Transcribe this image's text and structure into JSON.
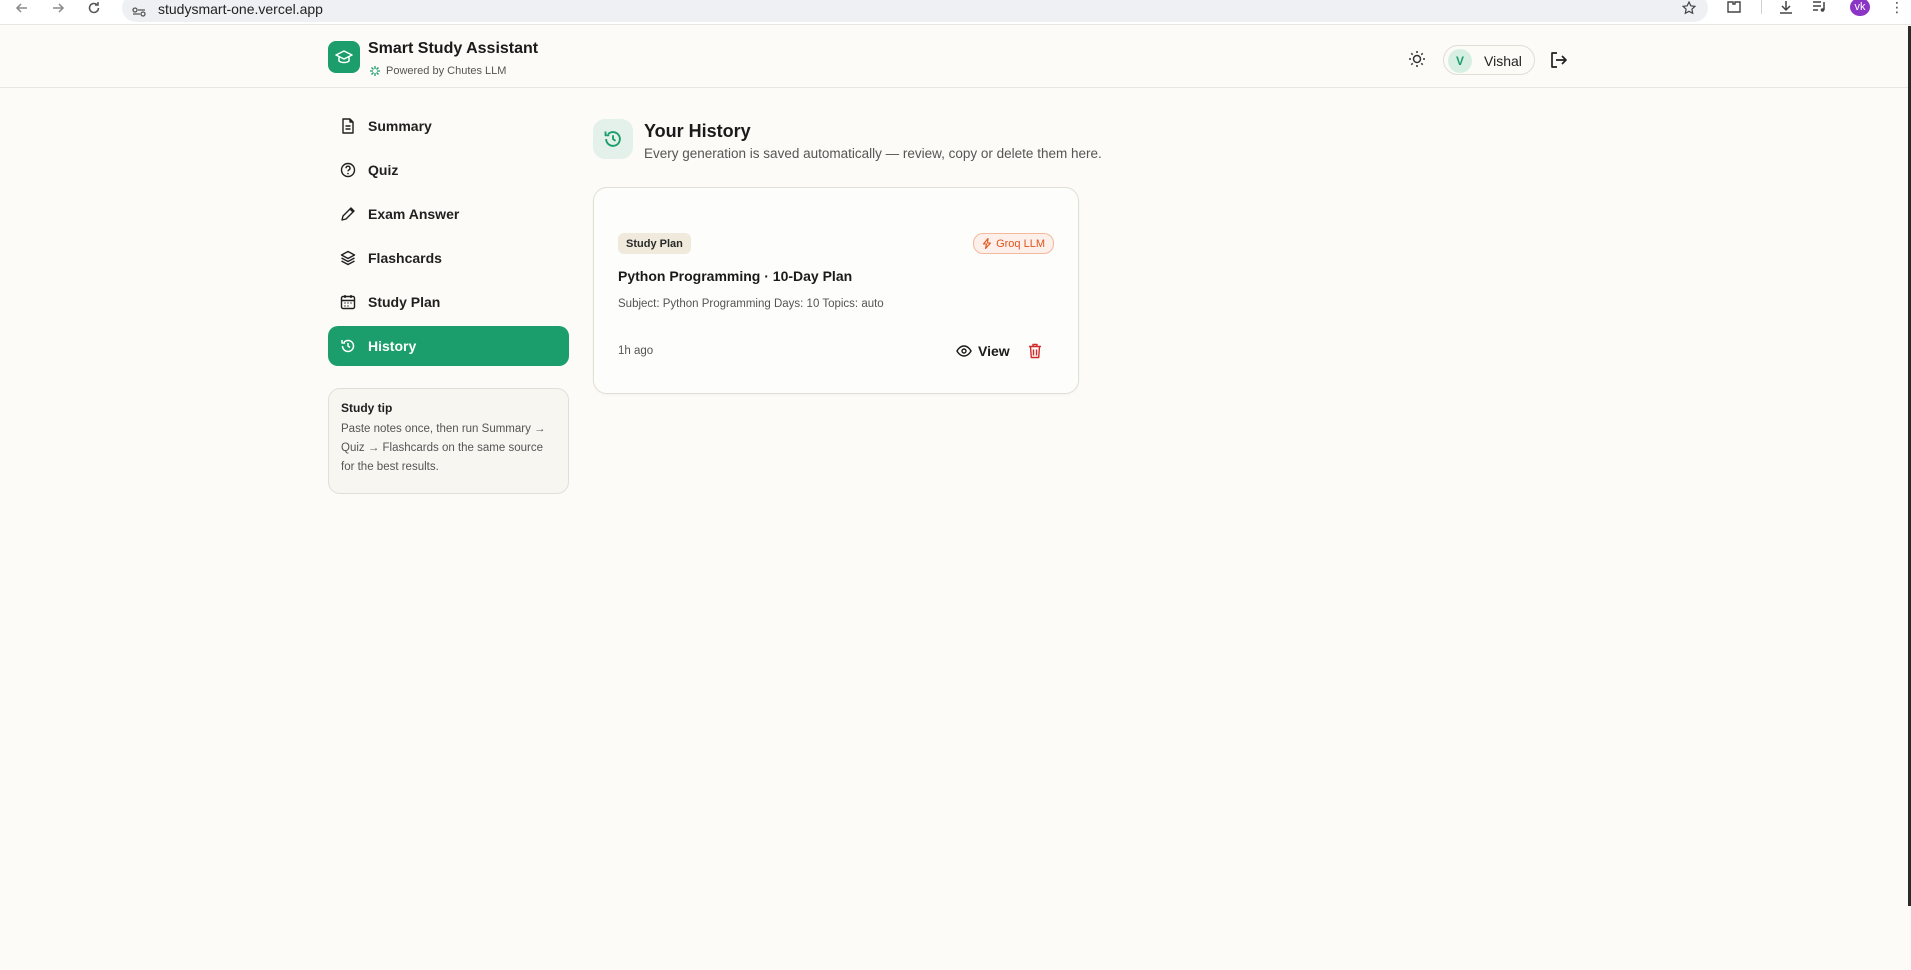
{
  "browser": {
    "url": "studysmart-one.vercel.app",
    "profile_initials": "vk",
    "profile_color": "#8b35c7"
  },
  "header": {
    "app_title": "Smart Study Assistant",
    "powered_by": "Powered by Chutes LLM",
    "user_initial": "V",
    "user_name": "Vishal",
    "accent_color": "#1b9e6b"
  },
  "sidebar": {
    "items": [
      {
        "label": "Summary",
        "icon": "document-icon",
        "active": false
      },
      {
        "label": "Quiz",
        "icon": "question-circle-icon",
        "active": false
      },
      {
        "label": "Exam Answer",
        "icon": "pen-icon",
        "active": false
      },
      {
        "label": "Flashcards",
        "icon": "layers-icon",
        "active": false
      },
      {
        "label": "Study Plan",
        "icon": "calendar-icon",
        "active": false
      },
      {
        "label": "History",
        "icon": "history-icon",
        "active": true
      }
    ],
    "tip": {
      "title": "Study tip",
      "text": "Paste notes once, then run Summary → Quiz → Flashcards on the same source for the best results."
    }
  },
  "main": {
    "title": "Your History",
    "subtitle": "Every generation is saved automatically — review, copy or delete them here.",
    "cards": [
      {
        "type_badge": "Study Plan",
        "model_badge": "Groq LLM",
        "title": "Python Programming · 10-Day Plan",
        "meta": "Subject: Python Programming Days: 10 Topics: auto",
        "time": "1h ago",
        "view_label": "View"
      }
    ]
  }
}
